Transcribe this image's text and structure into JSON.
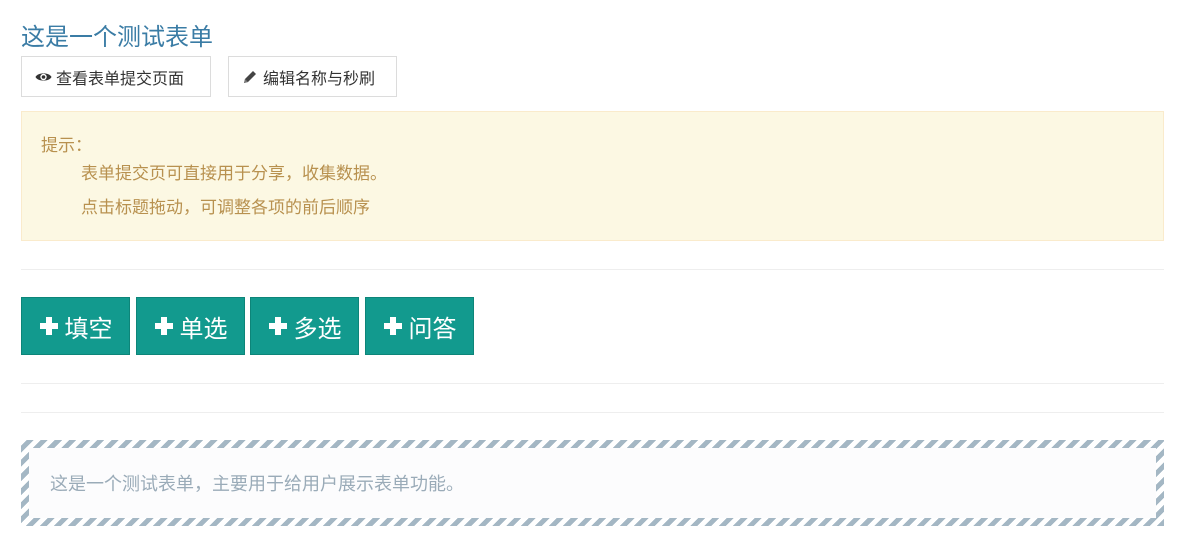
{
  "form": {
    "title": "这是一个测试表单",
    "description": "这是一个测试表单，主要用于给用户展示表单功能。"
  },
  "toolbar": {
    "view_label": "查看表单提交页面",
    "edit_label": "编辑名称与秒刷",
    "view_icon": "eye-icon",
    "edit_icon": "pencil-icon"
  },
  "tip": {
    "title": "提示：",
    "lines": [
      "表单提交页可直接用于分享，收集数据。",
      "点击标题拖动，可调整各项的前后顺序"
    ]
  },
  "add_buttons": [
    {
      "label": "填空",
      "icon": "plus-icon"
    },
    {
      "label": "单选",
      "icon": "plus-icon"
    },
    {
      "label": "多选",
      "icon": "plus-icon"
    },
    {
      "label": "问答",
      "icon": "plus-icon"
    }
  ],
  "colors": {
    "title": "#3a7ca5",
    "accent": "#129a8e",
    "tip_background": "#fcf8e3",
    "tip_text": "#b8914f"
  }
}
